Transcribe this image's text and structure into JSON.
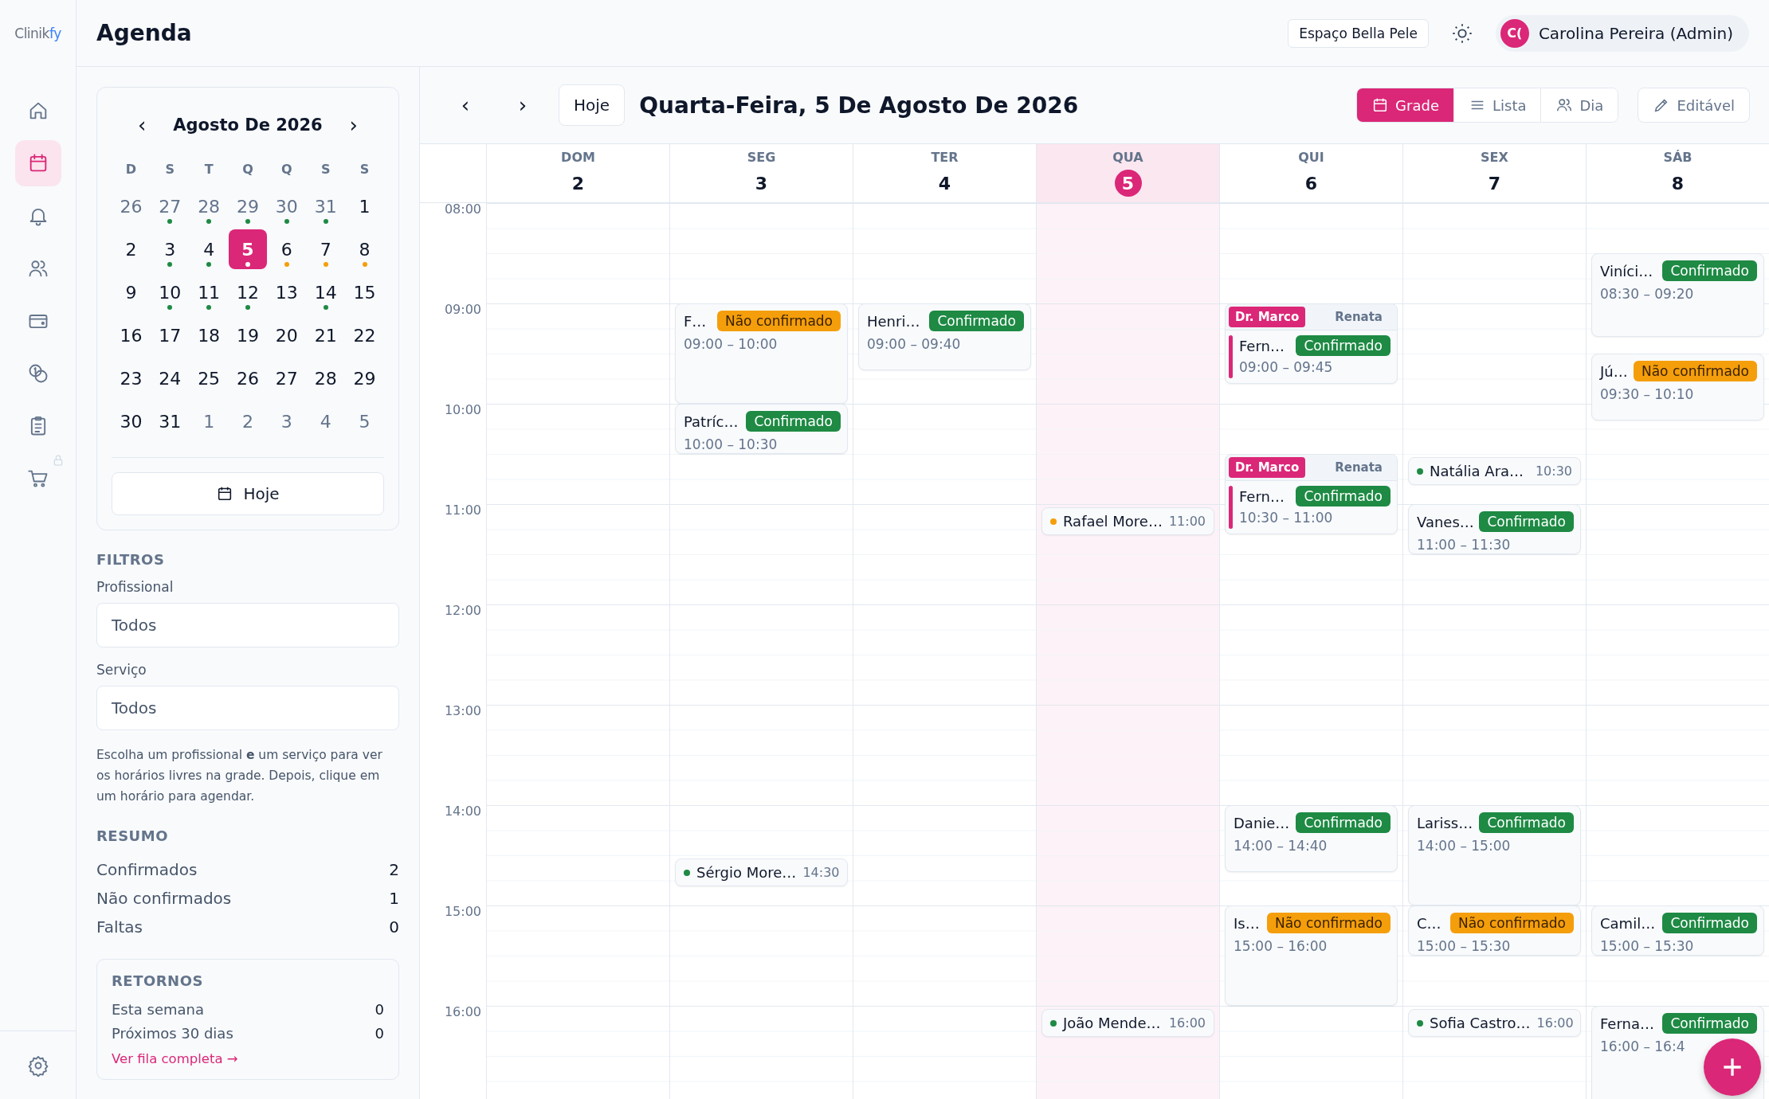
{
  "logo": {
    "text": "Clinik",
    "accent": "fy"
  },
  "nav": {
    "items": [
      {
        "selected": false,
        "locked": false
      },
      {
        "selected": true,
        "locked": false
      },
      {
        "selected": false,
        "locked": false
      },
      {
        "selected": false,
        "locked": false
      },
      {
        "selected": false,
        "locked": false
      },
      {
        "selected": false,
        "locked": false
      },
      {
        "selected": false,
        "locked": false
      },
      {
        "selected": false,
        "locked": true
      }
    ]
  },
  "header": {
    "title": "Agenda",
    "clinic": "Espaço Bella Pele",
    "user": {
      "initials": "C(",
      "name": "Carolina Pereira (Admin)"
    }
  },
  "mini_calendar": {
    "prev": "‹",
    "next": "›",
    "month": "Agosto De 2026",
    "weekdays": [
      "D",
      "S",
      "T",
      "Q",
      "Q",
      "S",
      "S"
    ],
    "days": [
      {
        "label": "26",
        "muted": true,
        "selected": false
      },
      {
        "label": "27",
        "muted": true,
        "selected": false,
        "color": "#1e8a44"
      },
      {
        "label": "28",
        "muted": true,
        "selected": false,
        "color": "#1e8a44"
      },
      {
        "label": "29",
        "muted": true,
        "selected": false,
        "color": "#1e8a44"
      },
      {
        "label": "30",
        "muted": true,
        "selected": false,
        "color": "#1e8a44"
      },
      {
        "label": "31",
        "muted": true,
        "selected": false,
        "color": "#1e8a44"
      },
      {
        "label": "1",
        "muted": false,
        "selected": false
      },
      {
        "label": "2",
        "muted": false,
        "selected": false
      },
      {
        "label": "3",
        "muted": false,
        "selected": false,
        "color": "#1e8a44"
      },
      {
        "label": "4",
        "muted": false,
        "selected": false,
        "color": "#1e8a44"
      },
      {
        "label": "5",
        "muted": false,
        "selected": true,
        "color": "#ffffff"
      },
      {
        "label": "6",
        "muted": false,
        "selected": false,
        "color": "#f59e0b"
      },
      {
        "label": "7",
        "muted": false,
        "selected": false,
        "color": "#f59e0b"
      },
      {
        "label": "8",
        "muted": false,
        "selected": false,
        "color": "#f59e0b"
      },
      {
        "label": "9",
        "muted": false,
        "selected": false
      },
      {
        "label": "10",
        "muted": false,
        "selected": false,
        "color": "#1e8a44"
      },
      {
        "label": "11",
        "muted": false,
        "selected": false,
        "color": "#1e8a44"
      },
      {
        "label": "12",
        "muted": false,
        "selected": false,
        "color": "#1e8a44"
      },
      {
        "label": "13",
        "muted": false,
        "selected": false
      },
      {
        "label": "14",
        "muted": false,
        "selected": false,
        "color": "#1e8a44"
      },
      {
        "label": "15",
        "muted": false,
        "selected": false
      },
      {
        "label": "16",
        "muted": false,
        "selected": false
      },
      {
        "label": "17",
        "muted": false,
        "selected": false
      },
      {
        "label": "18",
        "muted": false,
        "selected": false
      },
      {
        "label": "19",
        "muted": false,
        "selected": false
      },
      {
        "label": "20",
        "muted": false,
        "selected": false
      },
      {
        "label": "21",
        "muted": false,
        "selected": false
      },
      {
        "label": "22",
        "muted": false,
        "selected": false
      },
      {
        "label": "23",
        "muted": false,
        "selected": false
      },
      {
        "label": "24",
        "muted": false,
        "selected": false
      },
      {
        "label": "25",
        "muted": false,
        "selected": false
      },
      {
        "label": "26",
        "muted": false,
        "selected": false
      },
      {
        "label": "27",
        "muted": false,
        "selected": false
      },
      {
        "label": "28",
        "muted": false,
        "selected": false
      },
      {
        "label": "29",
        "muted": false,
        "selected": false
      },
      {
        "label": "30",
        "muted": false,
        "selected": false
      },
      {
        "label": "31",
        "muted": false,
        "selected": false
      },
      {
        "label": "1",
        "muted": true,
        "selected": false
      },
      {
        "label": "2",
        "muted": true,
        "selected": false
      },
      {
        "label": "3",
        "muted": true,
        "selected": false
      },
      {
        "label": "4",
        "muted": true,
        "selected": false
      },
      {
        "label": "5",
        "muted": true,
        "selected": false
      }
    ],
    "today_button": "Hoje"
  },
  "filters": {
    "heading": "FILTROS",
    "fields": [
      {
        "label": "Profissional",
        "value": "Todos"
      },
      {
        "label": "Serviço",
        "value": "Todos"
      }
    ],
    "hint": "Escolha um profissional **e** um serviço para ver os horários livres na grade. Depois, clique em um horário para agendar."
  },
  "summary": {
    "heading": "RESUMO",
    "rows": [
      {
        "label": "Confirmados",
        "value": "2"
      },
      {
        "label": "Não confirmados",
        "value": "1"
      },
      {
        "label": "Faltas",
        "value": "0"
      }
    ]
  },
  "returns": {
    "heading": "RETORNOS",
    "rows": [
      {
        "label": "Esta semana",
        "value": "0"
      },
      {
        "label": "Próximos 30 dias",
        "value": "0"
      }
    ],
    "link": "Ver fila completa →"
  },
  "toolbar": {
    "prev": "‹",
    "next": "›",
    "today": "Hoje",
    "date": "Quarta-Feira, 5 De Agosto De 2026",
    "views": [
      {
        "label": "Grade",
        "selected": true
      },
      {
        "label": "Lista",
        "selected": false
      },
      {
        "label": "Dia",
        "selected": false
      }
    ],
    "edit": "Editável"
  },
  "grid": {
    "hours": [
      "08:00",
      "09:00",
      "10:00",
      "11:00",
      "12:00",
      "13:00",
      "14:00",
      "15:00",
      "16:00"
    ],
    "days": [
      {
        "name": "DOM",
        "number": "2",
        "today": false
      },
      {
        "name": "SEG",
        "number": "3",
        "today": false,
        "events": [
          {
            "kind": "card",
            "name": "F…",
            "badge": "Não confirmado",
            "confirmed": false,
            "time": "09:00 – 10:00"
          },
          {
            "kind": "card",
            "name": "Patríc…",
            "badge": "Confirmado",
            "confirmed": true,
            "time": "10:00 – 10:30"
          },
          {
            "kind": "dot",
            "name": "Sérgio More…",
            "time": "14:30",
            "color": "#1e8a44"
          }
        ]
      },
      {
        "name": "TER",
        "number": "4",
        "today": false,
        "events": [
          {
            "kind": "card",
            "name": "Henri…",
            "badge": "Confirmado",
            "confirmed": true,
            "time": "09:00 – 09:40"
          }
        ]
      },
      {
        "name": "QUA",
        "number": "5",
        "today": true,
        "events": [
          {
            "kind": "dot",
            "name": "Rafael More…",
            "time": "11:00",
            "color": "#f59e0b"
          },
          {
            "kind": "dot",
            "name": "João Mende…",
            "time": "16:00",
            "color": "#1e8a44"
          }
        ]
      },
      {
        "name": "QUI",
        "number": "6",
        "today": false,
        "events": [
          {
            "kind": "group",
            "tabs": [
              {
                "label": "Dr. Marco",
                "selected": true
              },
              {
                "label": "Renata",
                "selected": false
              }
            ],
            "name": "Fern…",
            "badge": "Confirmado",
            "confirmed": true,
            "time": "09:00 – 09:45"
          },
          {
            "kind": "group",
            "tabs": [
              {
                "label": "Dr. Marco",
                "selected": true
              },
              {
                "label": "Renata",
                "selected": false
              }
            ],
            "name": "Fern…",
            "badge": "Confirmado",
            "confirmed": true,
            "time": "10:30 – 11:00"
          },
          {
            "kind": "card",
            "name": "Danie…",
            "badge": "Confirmado",
            "confirmed": true,
            "time": "14:00 – 14:40"
          },
          {
            "kind": "card",
            "name": "Is…",
            "badge": "Não confirmado",
            "confirmed": false,
            "time": "15:00 – 16:00"
          }
        ]
      },
      {
        "name": "SEX",
        "number": "7",
        "today": false,
        "events": [
          {
            "kind": "dot",
            "name": "Natália Ara…",
            "time": "10:30",
            "color": "#1e8a44"
          },
          {
            "kind": "card",
            "name": "Vanes…",
            "badge": "Confirmado",
            "confirmed": true,
            "time": "11:00 – 11:30"
          },
          {
            "kind": "card",
            "name": "Lariss…",
            "badge": "Confirmado",
            "confirmed": true,
            "time": "14:00 – 15:00"
          },
          {
            "kind": "card",
            "name": "C…",
            "badge": "Não confirmado",
            "confirmed": false,
            "time": "15:00 – 15:30"
          },
          {
            "kind": "dot",
            "name": "Sofia Castro…",
            "time": "16:00",
            "color": "#1e8a44"
          }
        ]
      },
      {
        "name": "SÁB",
        "number": "8",
        "today": false,
        "events": [
          {
            "kind": "card",
            "name": "Viníci…",
            "badge": "Confirmado",
            "confirmed": true,
            "time": "08:30 – 09:20"
          },
          {
            "kind": "card",
            "name": "Jú…",
            "badge": "Não confirmado",
            "confirmed": false,
            "time": "09:30 – 10:10"
          },
          {
            "kind": "card",
            "name": "Camil…",
            "badge": "Confirmado",
            "confirmed": true,
            "time": "15:00 – 15:30"
          },
          {
            "kind": "card",
            "name": "Ferna…",
            "badge": "Confirmado",
            "confirmed": true,
            "time": "16:00 – 16:4"
          }
        ]
      }
    ]
  }
}
